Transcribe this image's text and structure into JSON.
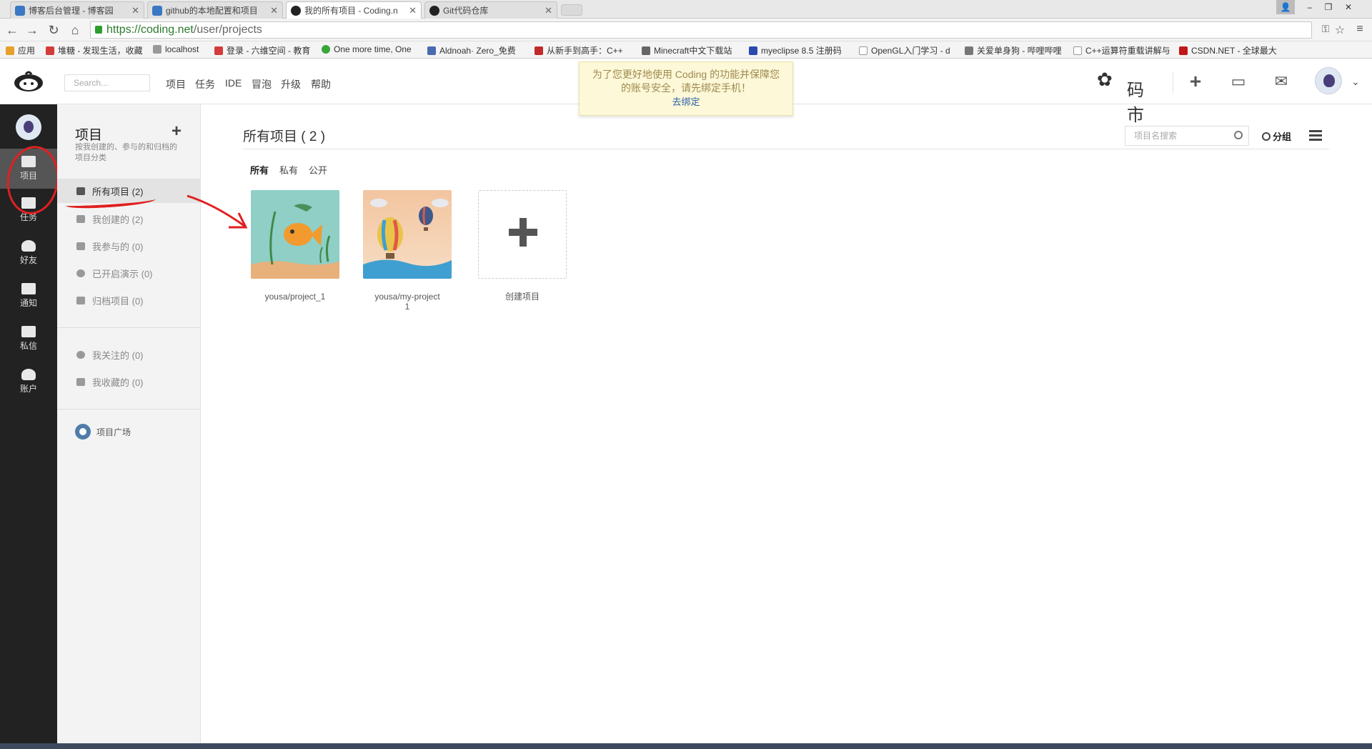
{
  "browser": {
    "tabs": [
      {
        "title": "博客后台管理 - 博客园"
      },
      {
        "title": "github的本地配置和项目"
      },
      {
        "title": "我的所有项目 - Coding.n"
      },
      {
        "title": "Git代码仓库"
      }
    ],
    "url_scheme": "https://",
    "url_domain": "coding.net",
    "url_path": "/user/projects",
    "bookmarks": [
      "应用",
      "堆糖 - 发现生活，收藏",
      "localhost",
      "登录 - 六维空间 - 教育",
      "One more time, One",
      "Aldnoah· Zero_免费",
      "从新手到高手：C++",
      "Minecraft中文下载站",
      "myeclipse 8.5 注册码",
      "OpenGL入门学习 - d",
      "关爱单身狗 - 哔哩哔哩",
      "C++运算符重载讲解与",
      "CSDN.NET - 全球最大"
    ]
  },
  "header": {
    "search_placeholder": "Search...",
    "nav": [
      "项目",
      "任务",
      "IDE",
      "冒泡",
      "升级",
      "帮助"
    ],
    "notice_line1": "为了您更好地使用 Coding 的功能并保障您",
    "notice_line2": "的账号安全，请先绑定手机！",
    "notice_link": "去绑定",
    "brand_text": "码 市"
  },
  "rail": {
    "items": [
      "项目",
      "任务",
      "好友",
      "通知",
      "私信",
      "账户"
    ]
  },
  "sidebar": {
    "title": "项目",
    "desc": "按我创建的、参与的和归档的项目分类",
    "items": [
      {
        "label": "所有项目 (2)"
      },
      {
        "label": "我创建的 (2)"
      },
      {
        "label": "我参与的 (0)"
      },
      {
        "label": "已开启演示 (0)"
      },
      {
        "label": "归档项目 (0)"
      }
    ],
    "items2": [
      {
        "label": "我关注的 (0)"
      },
      {
        "label": "我收藏的 (0)"
      }
    ],
    "square": "项目广场"
  },
  "main": {
    "title": "所有项目 ( 2 )",
    "search_placeholder": "项目名搜索",
    "group_label": "分组",
    "filters": [
      "所有",
      "私有",
      "公开"
    ],
    "projects": [
      {
        "name": "yousa/project_1"
      },
      {
        "name": "yousa/my-project",
        "name_line2": "1"
      }
    ],
    "create_label": "创建项目"
  },
  "colors": {
    "rail_bg": "#222222",
    "annotation_red": "#e02020",
    "notice_bg": "#fcf8d8",
    "link_blue": "#2c5fa8"
  }
}
